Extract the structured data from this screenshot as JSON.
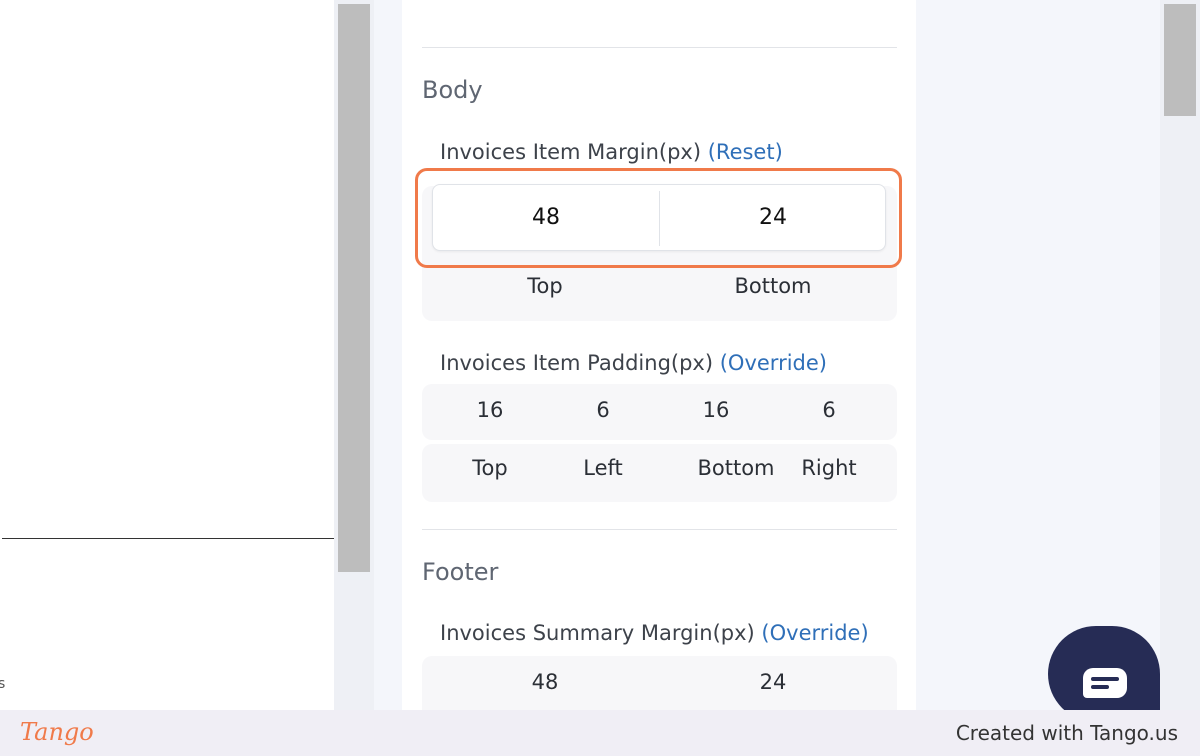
{
  "body_section": {
    "title": "Body",
    "margin": {
      "label": "Invoices Item Margin(px)",
      "action": "(Reset)",
      "values": [
        "48",
        "24"
      ],
      "captions": [
        "Top",
        "Bottom"
      ]
    },
    "padding": {
      "label": "Invoices Item Padding(px)",
      "action": "(Override)",
      "values": [
        "16",
        "6",
        "16",
        "6"
      ],
      "captions": [
        "Top",
        "Left",
        "Bottom",
        "Right"
      ]
    }
  },
  "footer_section": {
    "title": "Footer",
    "summary_margin": {
      "label": "Invoices Summary Margin(px)",
      "action": "(Override)",
      "values": [
        "48",
        "24"
      ]
    }
  },
  "watermark": {
    "logo": "Tango",
    "credit": "Created with Tango.us"
  },
  "colors": {
    "highlight": "#f07a4a",
    "link": "#2f6fb8",
    "chat_bubble": "#262c55"
  },
  "icons": [
    "chat-icon"
  ]
}
